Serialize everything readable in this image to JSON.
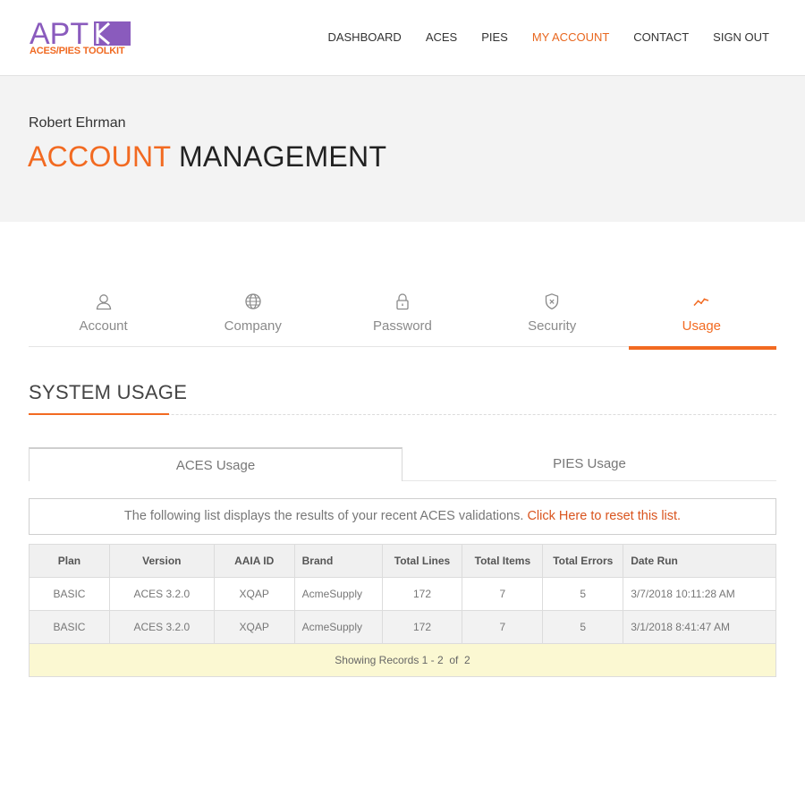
{
  "header": {
    "logo": {
      "brand": "APT",
      "tagline": "ACES/PIES TOOLKIT"
    },
    "nav": [
      {
        "label": "DASHBOARD",
        "active": false
      },
      {
        "label": "ACES",
        "active": false
      },
      {
        "label": "PIES",
        "active": false
      },
      {
        "label": "MY ACCOUNT",
        "active": true
      },
      {
        "label": "CONTACT",
        "active": false
      },
      {
        "label": "SIGN OUT",
        "active": false
      }
    ]
  },
  "hero": {
    "user_name": "Robert Ehrman",
    "title_accent": "ACCOUNT",
    "title_rest": "MANAGEMENT"
  },
  "tabs": [
    {
      "label": "Account",
      "icon": "user-icon",
      "active": false
    },
    {
      "label": "Company",
      "icon": "globe-icon",
      "active": false
    },
    {
      "label": "Password",
      "icon": "lock-icon",
      "active": false
    },
    {
      "label": "Security",
      "icon": "shield-icon",
      "active": false
    },
    {
      "label": "Usage",
      "icon": "trend-icon",
      "active": true
    }
  ],
  "section": {
    "title": "SYSTEM USAGE"
  },
  "subtabs": [
    {
      "label": "ACES Usage",
      "active": true
    },
    {
      "label": "PIES Usage",
      "active": false
    }
  ],
  "info": {
    "text": "The following list displays the results of your recent ACES validations.",
    "link": "Click Here to reset this list."
  },
  "table": {
    "columns": [
      "Plan",
      "Version",
      "AAIA ID",
      "Brand",
      "Total Lines",
      "Total Items",
      "Total Errors",
      "Date Run"
    ],
    "rows": [
      [
        "BASIC",
        "ACES 3.2.0",
        "XQAP",
        "AcmeSupply",
        "172",
        "7",
        "5",
        "3/7/2018 10:11:28 AM"
      ],
      [
        "BASIC",
        "ACES 3.2.0",
        "XQAP",
        "AcmeSupply",
        "172",
        "7",
        "5",
        "3/1/2018 8:41:47 AM"
      ]
    ],
    "footer": "Showing Records 1 - 2  of  2"
  },
  "colors": {
    "accent": "#f26a21",
    "brand_purple": "#8a5bbd",
    "footer_bg": "#fbf8d2"
  }
}
